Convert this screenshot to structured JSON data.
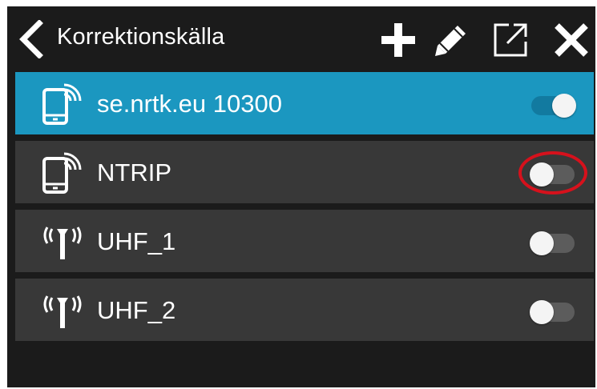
{
  "header": {
    "title": "Korrektionskälla",
    "icons": [
      "chevron-left-icon",
      "plus-icon",
      "pencil-icon",
      "external-window-icon",
      "close-icon"
    ]
  },
  "sources": [
    {
      "label": "se.nrtk.eu 10300",
      "icon": "phone-signal-icon",
      "enabled": true
    },
    {
      "label": "NTRIP",
      "icon": "phone-signal-icon",
      "enabled": false
    },
    {
      "label": "UHF_1",
      "icon": "antenna-icon",
      "enabled": false
    },
    {
      "label": "UHF_2",
      "icon": "antenna-icon",
      "enabled": false
    }
  ],
  "colors": {
    "background": "#1b1b1b",
    "row": "#383838",
    "active_row": "#1b97c0",
    "highlight_ring": "#d6111c"
  }
}
